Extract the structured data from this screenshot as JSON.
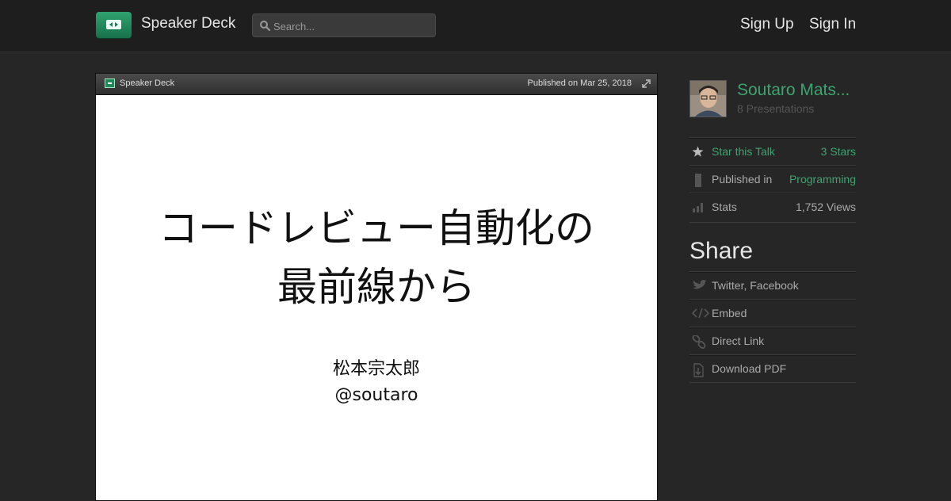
{
  "header": {
    "brand": "Speaker Deck",
    "search_placeholder": "Search...",
    "sign_up": "Sign Up",
    "sign_in": "Sign In",
    "icons": {
      "logo": "speakerdeck-logo-icon",
      "search": "search-icon"
    }
  },
  "player": {
    "bar_brand": "Speaker Deck",
    "published": "Published on Mar 25, 2018",
    "slide": {
      "title_line1": "コードレビュー自動化の",
      "title_line2": "最前線から",
      "author_name": "松本宗太郎",
      "author_handle": "@soutaro"
    }
  },
  "sidebar": {
    "author_name": "Soutaro Mats...",
    "presentations": "8 Presentations",
    "star_label": "Star this Talk",
    "star_count": "3 Stars",
    "published_label": "Published in",
    "published_value": "Programming",
    "stats_label": "Stats",
    "stats_value": "1,752 Views",
    "share_heading": "Share",
    "share_items": [
      {
        "label": "Twitter, Facebook",
        "icon": "bird-icon"
      },
      {
        "label": "Embed",
        "icon": "code-icon"
      },
      {
        "label": "Direct Link",
        "icon": "link-icon"
      },
      {
        "label": "Download PDF",
        "icon": "download-icon"
      }
    ]
  },
  "colors": {
    "accent_green": "#3fa36f",
    "background": "#262626",
    "header": "#1e1e1e"
  }
}
